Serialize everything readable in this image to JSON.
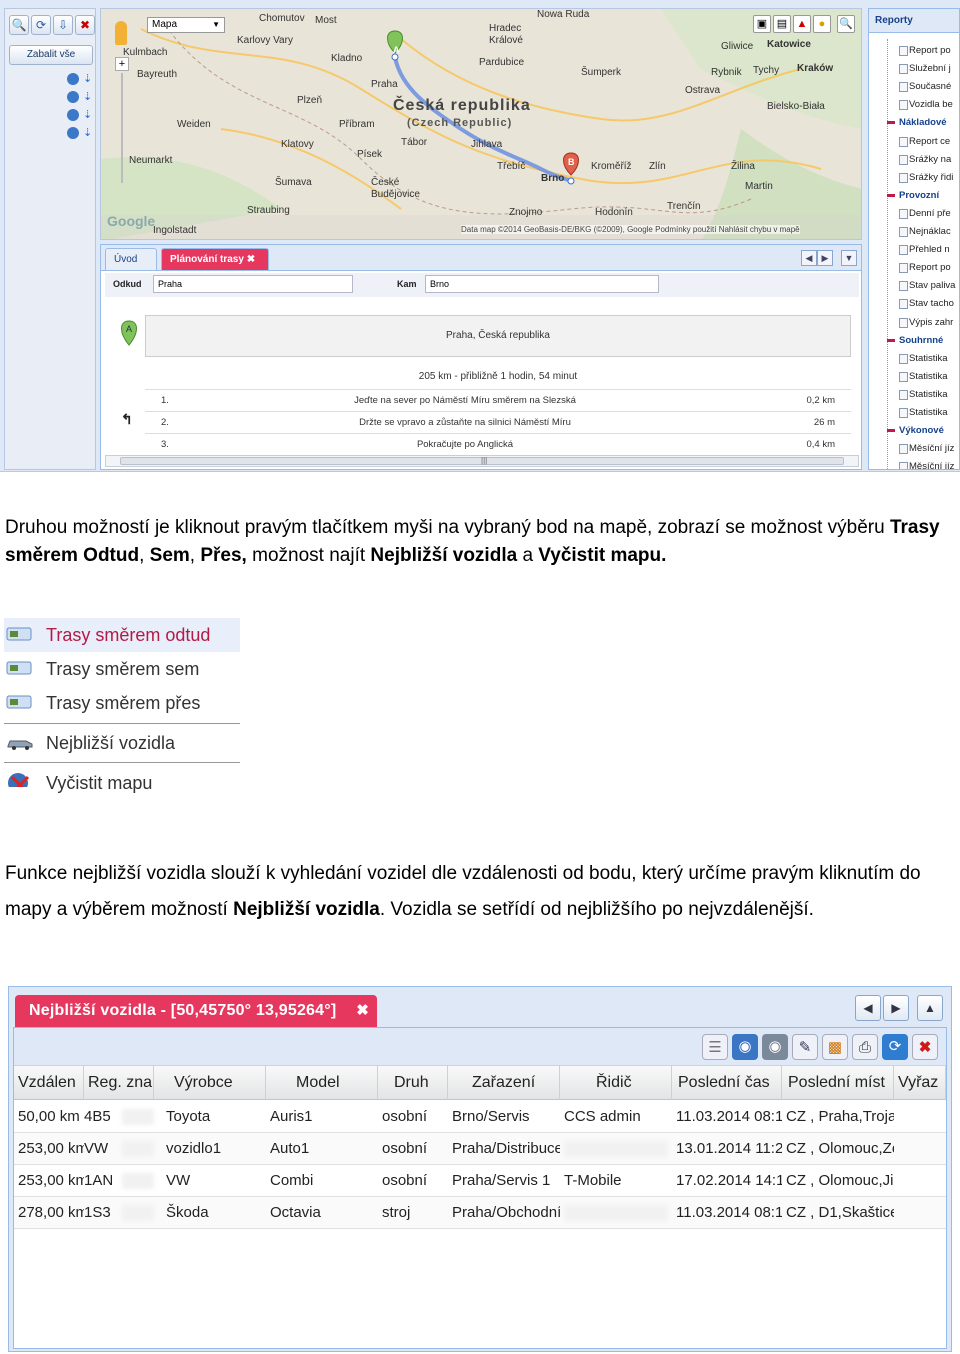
{
  "screenshot1": {
    "toolbar": {
      "collapse_label": "Zabalit vše"
    },
    "map": {
      "type_select": "Mapa",
      "labels": {
        "chomutov": "Chomutov",
        "most": "Most",
        "hradec": "Hradec Králové",
        "nova_ruda": "Nowa Ruda",
        "karlovy_vary": "Karlovy Vary",
        "kladno": "Kladno",
        "pardubice": "Pardubice",
        "sumperk": "Šumperk",
        "praha": "Praha",
        "plzen": "Plzeň",
        "pribram": "Příbram",
        "kolin_cz": "Česká republika",
        "czech_rep": "(Czech Republic)",
        "klatovy": "Klatovy",
        "tabor": "Tábor",
        "jihlava": "Jihlava",
        "pisek": "Písek",
        "trebic": "Třebíč",
        "kromeriz": "Kroměříž",
        "zlin": "Zlín",
        "brno": "Brno",
        "ceske_budejovice": "České Budějovice",
        "znojmo": "Znojmo",
        "hodonin": "Hodonín",
        "trencin": "Trenčín",
        "martin": "Martin",
        "zilina": "Žilina",
        "ostrava": "Ostrava",
        "bielsko": "Bielsko-Biała",
        "katowice": "Katowice",
        "gliwice": "Gliwice",
        "rybnik": "Rybnik",
        "tychy": "Tychy",
        "krakow": "Kraków",
        "kulmbach": "Kulmbach",
        "bayreuth": "Bayreuth",
        "weiden": "Weiden",
        "neumarkt": "Neumarkt",
        "straubing": "Straubing",
        "sumava": "Šumava",
        "ingolstadt": "Ingolstadt"
      },
      "pin_a": "A",
      "pin_b": "B",
      "credit": "Data map ©2014 GeoBasis-DE/BKG (©2009), Google   Podmínky použití   Nahlásit chybu v mapě",
      "google": "Google"
    },
    "route_panel": {
      "tabs": [
        "Úvod",
        "Plánování trasy"
      ],
      "from_label": "Odkud",
      "from_value": "Praha",
      "to_label": "Kam",
      "to_value": "Brno",
      "from_box": "Praha, Česká republika",
      "summary": "205 km - přibližně 1 hodin, 54 minut",
      "steps": [
        {
          "num": "1.",
          "desc": "Jeďte na sever po Náměstí Míru směrem na Slezská",
          "dist": "0,2 km"
        },
        {
          "num": "2.",
          "desc": "Držte se vpravo a zůstaňte na silnici Náměstí Míru",
          "dist": "26 m"
        },
        {
          "num": "3.",
          "desc": "Pokračujte po Anglická",
          "dist": "0,4 km"
        }
      ]
    },
    "reports": {
      "title": "Reporty",
      "items": [
        {
          "label": "Report po",
          "group": false
        },
        {
          "label": "Služební j",
          "group": false
        },
        {
          "label": "Současné",
          "group": false
        },
        {
          "label": "Vozidla be",
          "group": false
        },
        {
          "label": "Nákladové",
          "group": true
        },
        {
          "label": "Report ce",
          "group": false
        },
        {
          "label": "Srážky na",
          "group": false
        },
        {
          "label": "Srážky řidi",
          "group": false
        },
        {
          "label": "Provozní",
          "group": true
        },
        {
          "label": "Denní pře",
          "group": false
        },
        {
          "label": "Nejnáklac",
          "group": false
        },
        {
          "label": "Přehled n",
          "group": false
        },
        {
          "label": "Report po",
          "group": false
        },
        {
          "label": "Stav paliva",
          "group": false
        },
        {
          "label": "Stav tacho",
          "group": false
        },
        {
          "label": "Výpis zahr",
          "group": false
        },
        {
          "label": "Souhrnné",
          "group": true
        },
        {
          "label": "Statistika",
          "group": false
        },
        {
          "label": "Statistika",
          "group": false
        },
        {
          "label": "Statistika",
          "group": false
        },
        {
          "label": "Statistika",
          "group": false
        },
        {
          "label": "Výkonové",
          "group": true
        },
        {
          "label": "Měsíční jíz",
          "group": false
        },
        {
          "label": "Měsíční jíz",
          "group": false
        }
      ]
    }
  },
  "para1": {
    "t1": "Druhou možností je kliknout pravým tlačítkem myši na vybraný bod na mapě, zobrazí se možnost výběru ",
    "b1": "Trasy směrem Odtud",
    "t2": ", ",
    "b2": "Sem",
    "t3": ", ",
    "b3": "Přes,",
    "t4": " možnost najít ",
    "b4": "Nejbližší vozidla",
    "t5": " a ",
    "b5": "Vyčistit mapu."
  },
  "context_menu": {
    "items": [
      {
        "label": "Trasy směrem odtud",
        "icon": "route-from-icon"
      },
      {
        "label": "Trasy směrem sem",
        "icon": "route-to-icon"
      },
      {
        "label": "Trasy směrem přes",
        "icon": "route-via-icon"
      },
      {
        "label": "Nejbližší vozidla",
        "icon": "car-icon"
      },
      {
        "label": "Vyčistit mapu",
        "icon": "clear-map-icon"
      }
    ]
  },
  "para2": {
    "t1": "Funkce nejbližší vozidla slouží k vyhledání vozidel dle vzdálenosti od bodu, který určíme pravým kliknutím do mapy a výběrem možností ",
    "b1": "Nejbližší vozidla",
    "t2": ". Vozidla se setřídí od nejbližšího po nejvzdálenější."
  },
  "screenshot2": {
    "tab_title": "Nejbližší vozidla - [50,45750° 13,95264°]",
    "columns": [
      "Vzdálen",
      "Reg. zna",
      "Výrobce",
      "Model",
      "Druh",
      "Zařazení",
      "Řidič",
      "Poslední čas",
      "Poslední míst",
      "Vyřaz"
    ],
    "rows": [
      [
        "50,00 km",
        "4B5",
        "Toyota",
        "Auris1",
        "osobní",
        "Brno/Servis",
        "CCS admin",
        "11.03.2014 08:1",
        "CZ , Praha,Troja"
      ],
      [
        "253,00 km",
        "VW",
        "vozidlo1",
        "Auto1",
        "osobní",
        "Praha/Distribuce",
        "",
        "13.01.2014 11:2",
        "CZ , Olomouc,Ze"
      ],
      [
        "253,00 km",
        "1AN",
        "VW",
        "Combi",
        "osobní",
        "Praha/Servis 1",
        "T-Mobile",
        "17.02.2014 14:1",
        "CZ , Olomouc,Jil"
      ],
      [
        "278,00 km",
        "1S3",
        "Škoda",
        "Octavia",
        "stroj",
        "Praha/Obchodní",
        "",
        "11.03.2014 08:1",
        "CZ , D1,Skaštice"
      ]
    ]
  }
}
